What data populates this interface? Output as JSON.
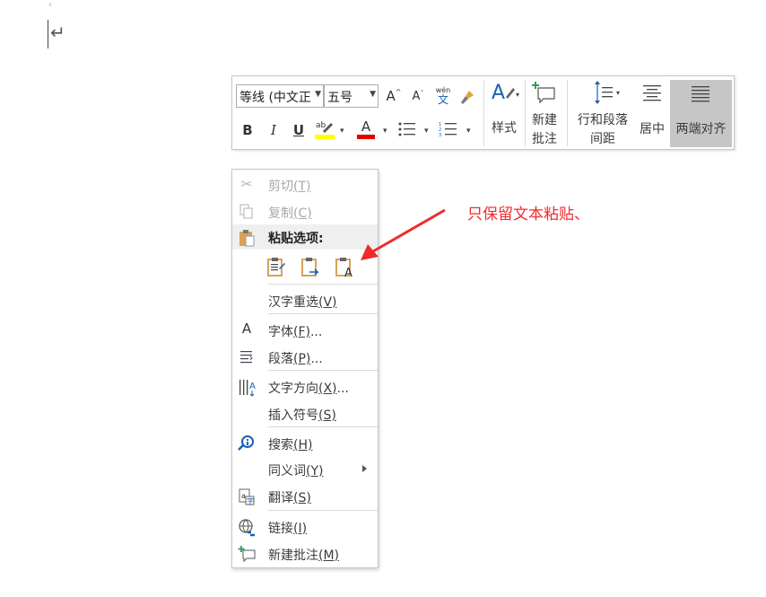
{
  "document": {
    "paragraph_mark": "↵"
  },
  "toolbar": {
    "font_name": "等线 (中文正",
    "font_size": "五号",
    "grow_font": "A",
    "shrink_font": "A",
    "phonetic_top": "wén",
    "phonetic_bottom": "文",
    "bold": "B",
    "italic": "I",
    "underline": "U",
    "font_color_letter": "A",
    "styles_label": "样式",
    "new_comment_label_1": "新建",
    "new_comment_label_2": "批注",
    "line_spacing_label_1": "行和段落",
    "line_spacing_label_2": "间距",
    "center_label": "居中",
    "justify_label": "两端对齐",
    "colors": {
      "highlight": "#ffff00",
      "font_color": "#e00000",
      "selected_bg": "#c6c6c6"
    }
  },
  "context_menu": {
    "cut": {
      "label": "剪切",
      "key": "(T)",
      "enabled": false
    },
    "copy": {
      "label": "复制",
      "key": "(C)",
      "enabled": false
    },
    "paste_options": {
      "label": "粘贴选项:"
    },
    "reconvert": {
      "label": "汉字重选",
      "key": "(V)"
    },
    "font": {
      "label": "字体",
      "key": "(F)",
      "suffix": "...",
      "icon_letter": "A"
    },
    "paragraph": {
      "label": "段落",
      "key": "(P)",
      "suffix": "..."
    },
    "text_direction": {
      "label": "文字方向",
      "key": "(X)",
      "suffix": "..."
    },
    "insert_symbol": {
      "label": "插入符号",
      "key": "(S)"
    },
    "search": {
      "label": "搜索",
      "key": "(H)"
    },
    "synonyms": {
      "label": "同义词",
      "key": "(Y)"
    },
    "translate": {
      "label": "翻译",
      "key": "(S)"
    },
    "link": {
      "label": "链接",
      "key": "(I)"
    },
    "new_comment": {
      "label": "新建批注",
      "key": "(M)"
    }
  },
  "annotation": {
    "text": "只保留文本粘贴、",
    "color": "#ef2b2b"
  }
}
